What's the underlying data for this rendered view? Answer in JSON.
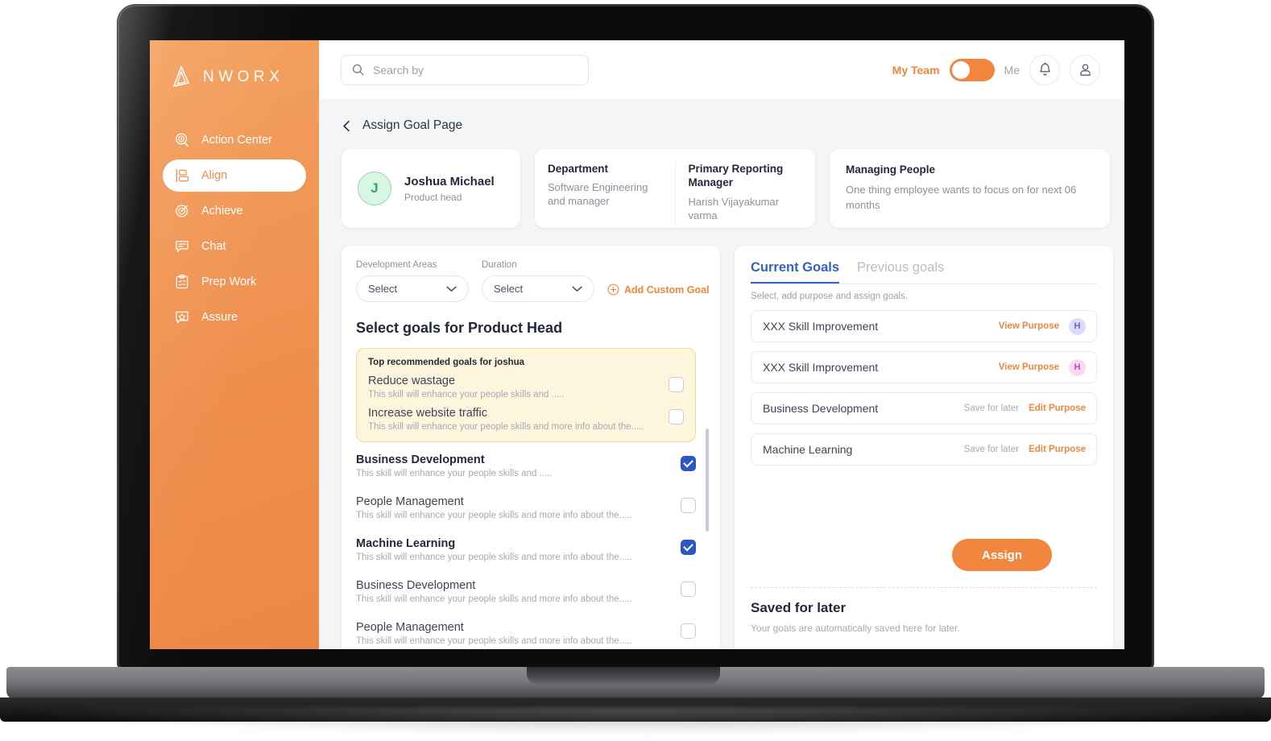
{
  "brand": {
    "name": "NWORX",
    "accent": "#f2863f"
  },
  "sidebar": {
    "items": [
      {
        "label": "Action Center",
        "icon": "target-search-icon",
        "active": false
      },
      {
        "label": "Align",
        "icon": "align-blocks-icon",
        "active": true
      },
      {
        "label": "Achieve",
        "icon": "target-icon",
        "active": false
      },
      {
        "label": "Chat",
        "icon": "chat-bubble-icon",
        "active": false
      },
      {
        "label": "Prep Work",
        "icon": "clipboard-checklist-icon",
        "active": false
      },
      {
        "label": "Assure",
        "icon": "star-badge-icon",
        "active": false
      }
    ]
  },
  "topbar": {
    "search_placeholder": "Search by",
    "search_value": "",
    "toggle_left_label": "My Team",
    "toggle_right_label": "Me",
    "toggle_state": "My Team",
    "bell_icon": "bell-icon",
    "profile_icon": "user-icon"
  },
  "breadcrumb": {
    "back_icon": "chevron-left-icon",
    "title": "Assign Goal Page"
  },
  "cards": {
    "person": {
      "initial": "J",
      "name": "Joshua Michael",
      "role": "Product head"
    },
    "department": {
      "title": "Department",
      "value": "Software Engineering and manager"
    },
    "manager": {
      "title": "Primary Reporting Manager",
      "value": "Harish Vijayakumar varma"
    },
    "focus": {
      "title": "Managing People",
      "body": "One thing employee wants to focus on for next 06 months"
    }
  },
  "left_panel": {
    "filters": [
      {
        "label": "Development Areas",
        "value": "Select"
      },
      {
        "label": "Duration",
        "value": "Select"
      }
    ],
    "add_custom_goal": "Add Custom Goal",
    "section_title": "Select goals for Product Head",
    "recommended": {
      "heading": "Top recommended goals for joshua",
      "items": [
        {
          "name": "Reduce wastage",
          "desc": "This skill will enhance your people skills and .....",
          "checked": false
        },
        {
          "name": "Increase website traffic",
          "desc": "This skill will enhance your people skills and  more info about the.....",
          "checked": false
        }
      ]
    },
    "goals": [
      {
        "name": "Business Development",
        "desc": "This skill will enhance your people skills and .....",
        "checked": true
      },
      {
        "name": "People Management",
        "desc": "This skill will enhance your people skills and  more info about the.....",
        "checked": false
      },
      {
        "name": "Machine Learning",
        "desc": "This skill will enhance your people skills and  more info about the.....",
        "checked": true
      },
      {
        "name": "Business Development",
        "desc": "This skill will enhance your people skills and  more info about the.....",
        "checked": false
      },
      {
        "name": "People Management",
        "desc": "This skill will enhance your people skills and  more info about the.....",
        "checked": false
      }
    ]
  },
  "right_panel": {
    "tabs": [
      {
        "label": "Current Goals",
        "active": true
      },
      {
        "label": "Previous goals",
        "active": false
      }
    ],
    "subtitle": "Select, add purpose and assign goals.",
    "rows": [
      {
        "name": "XXX Skill Improvement",
        "action": "View Purpose",
        "secondary": "",
        "badge": "H",
        "badge_bg": "#dcdcfa",
        "badge_fg": "#6b5ce0"
      },
      {
        "name": "XXX Skill Improvement",
        "action": "View Purpose",
        "secondary": "",
        "badge": "H",
        "badge_bg": "#fbd9f1",
        "badge_fg": "#b84fc0"
      },
      {
        "name": "Business Development",
        "action": "Edit Purpose",
        "secondary": "Save for later",
        "badge": "",
        "badge_bg": "",
        "badge_fg": ""
      },
      {
        "name": "Machine Learning",
        "action": "Edit Purpose",
        "secondary": "Save for later",
        "badge": "",
        "badge_bg": "",
        "badge_fg": ""
      }
    ],
    "assign_button": "Assign",
    "saved_title": "Saved for later",
    "saved_subtitle": "Your goals are automatically saved here for later."
  }
}
